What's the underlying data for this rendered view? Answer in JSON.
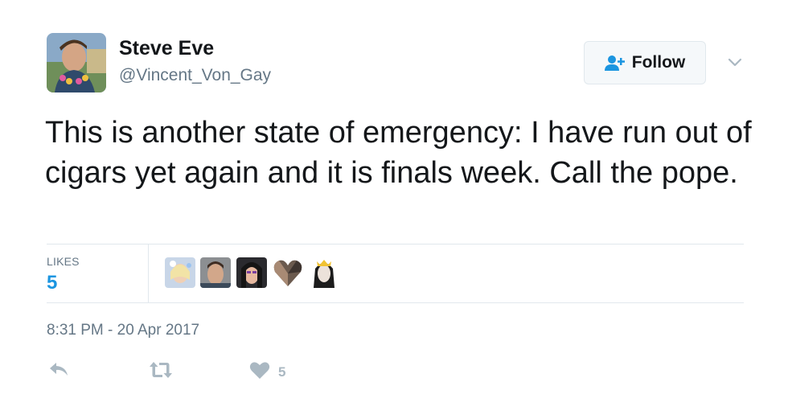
{
  "user": {
    "display_name": "Steve Eve",
    "handle": "@Vincent_Von_Gay"
  },
  "follow_button": {
    "label": "Follow",
    "icon": "follow-person-plus-icon"
  },
  "tweet": {
    "text": "This is another state of emergency: I have run out of cigars yet again and it is finals week. Call the pope."
  },
  "stats": {
    "likes_label": "LIKES",
    "likes_count": "5",
    "likers_count": 5
  },
  "timestamp": "8:31 PM - 20 Apr 2017",
  "actions": {
    "reply_icon": "reply-icon",
    "retweet_icon": "retweet-icon",
    "like_icon": "heart-icon",
    "like_count": "5"
  },
  "colors": {
    "accent": "#1b95e0",
    "muted": "#657786",
    "icon_gray": "#aab8c2",
    "border": "#e1e8ed"
  }
}
